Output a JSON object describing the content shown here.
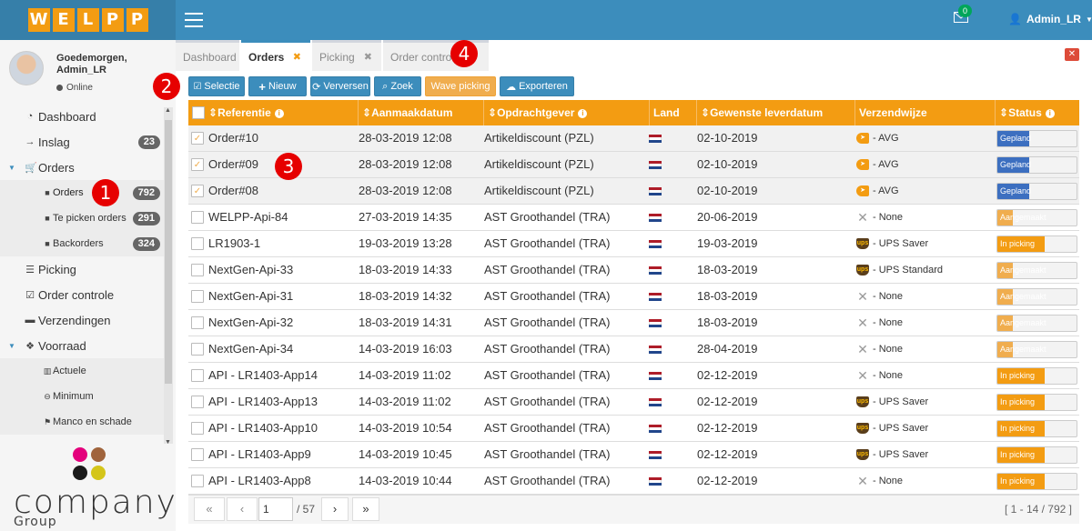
{
  "app": {
    "logo": [
      "W",
      "E",
      "L",
      "P",
      "P"
    ]
  },
  "topbar": {
    "mail_count": "0",
    "user": "Admin_LR"
  },
  "user_panel": {
    "greeting": "Goedemorgen,",
    "name": "Admin_LR",
    "status": "Online"
  },
  "sidebar": {
    "items": [
      {
        "label": "Dashboard",
        "icon": "dashboard-icon",
        "glyph": "◔",
        "level": 0
      },
      {
        "label": "Inslag",
        "icon": "arrow-right-icon",
        "glyph": "→",
        "badge": "23",
        "level": 0
      },
      {
        "label": "Orders",
        "icon": "cart-icon",
        "glyph": "🛒",
        "level": 0,
        "expanded": true
      },
      {
        "label": "Orders",
        "icon": "square-icon",
        "glyph": "■",
        "badge": "792",
        "level": 1,
        "active": true
      },
      {
        "label": "Te picken orders",
        "icon": "square-icon",
        "glyph": "■",
        "badge": "291",
        "level": 1
      },
      {
        "label": "Backorders",
        "icon": "square-icon",
        "glyph": "■",
        "badge": "324",
        "level": 1
      },
      {
        "label": "Picking",
        "icon": "list-icon",
        "glyph": "☰",
        "level": 0
      },
      {
        "label": "Order controle",
        "icon": "check-square-icon",
        "glyph": "☑",
        "level": 0
      },
      {
        "label": "Verzendingen",
        "icon": "truck-icon",
        "glyph": "▬",
        "level": 0
      },
      {
        "label": "Voorraad",
        "icon": "cubes-icon",
        "glyph": "❖",
        "level": 0,
        "expanded": true
      },
      {
        "label": "Actuele",
        "icon": "bar-chart-icon",
        "glyph": "▥",
        "level": 1
      },
      {
        "label": "Minimum",
        "icon": "minus-circle-icon",
        "glyph": "⊖",
        "level": 1
      },
      {
        "label": "Manco en schade",
        "icon": "flag-icon",
        "glyph": "⚑",
        "level": 1
      }
    ]
  },
  "branding": {
    "company": "company",
    "group": "Group"
  },
  "tabs": [
    {
      "label": "Dashboard",
      "closable": false
    },
    {
      "label": "Orders",
      "closable": true,
      "active": true
    },
    {
      "label": "Picking",
      "closable": true
    },
    {
      "label": "Order contro",
      "closable": false
    }
  ],
  "toolbar": {
    "selectie": "Selectie",
    "nieuw": "Nieuw",
    "verversen": "Verversen",
    "zoek": "Zoek",
    "wave": "Wave picking",
    "exporteren": "Exporteren"
  },
  "table": {
    "columns": [
      "Referentie",
      "Aanmaakdatum",
      "Opdrachtgever",
      "Land",
      "Gewenste leverdatum",
      "Verzendwijze",
      "Status"
    ],
    "rows": [
      {
        "ref": "Order#10",
        "date": "28-03-2019 12:08",
        "client": "Artikeldiscount (PZL)",
        "delivery": "02-10-2019",
        "ship_type": "avg",
        "ship": "- AVG",
        "status": "Gepland",
        "progress": 0.4,
        "checked": true
      },
      {
        "ref": "Order#09",
        "date": "28-03-2019 12:08",
        "client": "Artikeldiscount (PZL)",
        "delivery": "02-10-2019",
        "ship_type": "avg",
        "ship": "- AVG",
        "status": "Gepland",
        "progress": 0.4,
        "checked": true
      },
      {
        "ref": "Order#08",
        "date": "28-03-2019 12:08",
        "client": "Artikeldiscount (PZL)",
        "delivery": "02-10-2019",
        "ship_type": "avg",
        "ship": "- AVG",
        "status": "Gepland",
        "progress": 0.4,
        "checked": true
      },
      {
        "ref": "WELPP-Api-84",
        "date": "27-03-2019 14:35",
        "client": "AST Groothandel (TRA)",
        "delivery": "20-06-2019",
        "ship_type": "none",
        "ship": "- None",
        "status": "Aangemaakt",
        "progress": 0.2,
        "checked": false
      },
      {
        "ref": "LR1903-1",
        "date": "19-03-2019 13:28",
        "client": "AST Groothandel (TRA)",
        "delivery": "19-03-2019",
        "ship_type": "ups",
        "ship": "- UPS Saver",
        "status": "In picking",
        "progress": 0.6,
        "checked": false
      },
      {
        "ref": "NextGen-Api-33",
        "date": "18-03-2019 14:33",
        "client": "AST Groothandel (TRA)",
        "delivery": "18-03-2019",
        "ship_type": "ups",
        "ship": "- UPS Standard",
        "status": "Aangemaakt",
        "progress": 0.2,
        "checked": false
      },
      {
        "ref": "NextGen-Api-31",
        "date": "18-03-2019 14:32",
        "client": "AST Groothandel (TRA)",
        "delivery": "18-03-2019",
        "ship_type": "none",
        "ship": "- None",
        "status": "Aangemaakt",
        "progress": 0.2,
        "checked": false
      },
      {
        "ref": "NextGen-Api-32",
        "date": "18-03-2019 14:31",
        "client": "AST Groothandel (TRA)",
        "delivery": "18-03-2019",
        "ship_type": "none",
        "ship": "- None",
        "status": "Aangemaakt",
        "progress": 0.2,
        "checked": false
      },
      {
        "ref": "NextGen-Api-34",
        "date": "14-03-2019 16:03",
        "client": "AST Groothandel (TRA)",
        "delivery": "28-04-2019",
        "ship_type": "none",
        "ship": "- None",
        "status": "Aangemaakt",
        "progress": 0.2,
        "checked": false
      },
      {
        "ref": "API - LR1403-App14",
        "date": "14-03-2019 11:02",
        "client": "AST Groothandel (TRA)",
        "delivery": "02-12-2019",
        "ship_type": "none",
        "ship": "- None",
        "status": "In picking",
        "progress": 0.6,
        "checked": false
      },
      {
        "ref": "API - LR1403-App13",
        "date": "14-03-2019 11:02",
        "client": "AST Groothandel (TRA)",
        "delivery": "02-12-2019",
        "ship_type": "ups",
        "ship": "- UPS Saver",
        "status": "In picking",
        "progress": 0.6,
        "checked": false
      },
      {
        "ref": "API - LR1403-App10",
        "date": "14-03-2019 10:54",
        "client": "AST Groothandel (TRA)",
        "delivery": "02-12-2019",
        "ship_type": "ups",
        "ship": "- UPS Saver",
        "status": "In picking",
        "progress": 0.6,
        "checked": false
      },
      {
        "ref": "API - LR1403-App9",
        "date": "14-03-2019 10:45",
        "client": "AST Groothandel (TRA)",
        "delivery": "02-12-2019",
        "ship_type": "ups",
        "ship": "- UPS Saver",
        "status": "In picking",
        "progress": 0.6,
        "checked": false
      },
      {
        "ref": "API - LR1403-App8",
        "date": "14-03-2019 10:44",
        "client": "AST Groothandel (TRA)",
        "delivery": "02-12-2019",
        "ship_type": "none",
        "ship": "- None",
        "status": "In picking",
        "progress": 0.6,
        "checked": false
      }
    ]
  },
  "pager": {
    "page": "1",
    "total": "/ 57",
    "range": "[ 1 - 14 / 792 ]"
  },
  "annotations": [
    "1",
    "2",
    "3",
    "4"
  ],
  "colors": {
    "topbar": "#3c8dbc",
    "accent": "#f39c12",
    "gepland": "#3c6fc0",
    "aangemaakt": "#f0ad4e",
    "in_picking": "#f39c12"
  }
}
